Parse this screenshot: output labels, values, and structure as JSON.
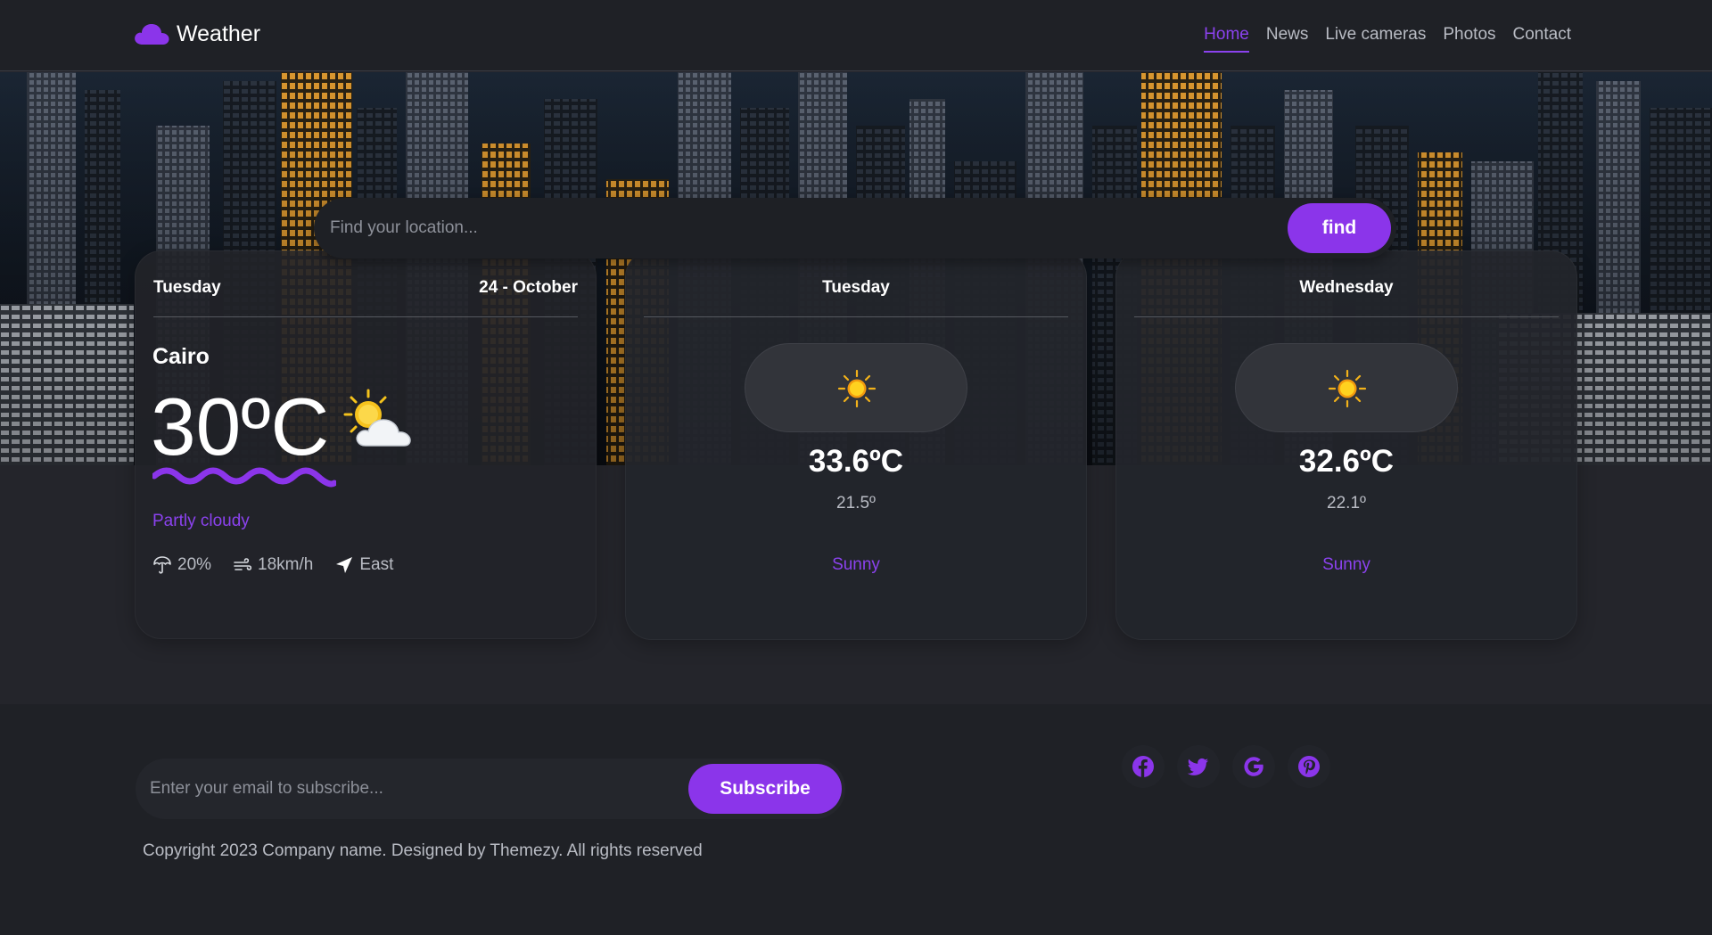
{
  "brand": {
    "name": "Weather",
    "icon": "cloud-icon"
  },
  "nav": {
    "items": [
      "Home",
      "News",
      "Live cameras",
      "Photos",
      "Contact"
    ],
    "active": "Home"
  },
  "search": {
    "placeholder": "Find your location...",
    "button_label": "find"
  },
  "today": {
    "day": "Tuesday",
    "date": "24 - October",
    "city": "Cairo",
    "temp": "30ºC",
    "condition": "Partly cloudy",
    "condition_icon": "partly-cloudy-icon",
    "rain": "20%",
    "wind": "18km/h",
    "direction": "East"
  },
  "forecast": [
    {
      "day": "Tuesday",
      "icon": "sun-icon",
      "max": "33.6ºC",
      "min": "21.5º",
      "condition": "Sunny"
    },
    {
      "day": "Wednesday",
      "icon": "sun-icon",
      "max": "32.6ºC",
      "min": "22.1º",
      "condition": "Sunny"
    }
  ],
  "footer": {
    "email_placeholder": "Enter your email to subscribe...",
    "subscribe_label": "Subscribe",
    "copyright": "Copyright 2023 Company name. Designed by Themezy. All rights reserved",
    "socials": [
      "facebook-icon",
      "twitter-icon",
      "google-icon",
      "pinterest-icon"
    ]
  },
  "colors": {
    "accent": "#8b35ea",
    "background": "#24252b",
    "card": "#23252b",
    "text_muted": "#b9bcc4"
  }
}
